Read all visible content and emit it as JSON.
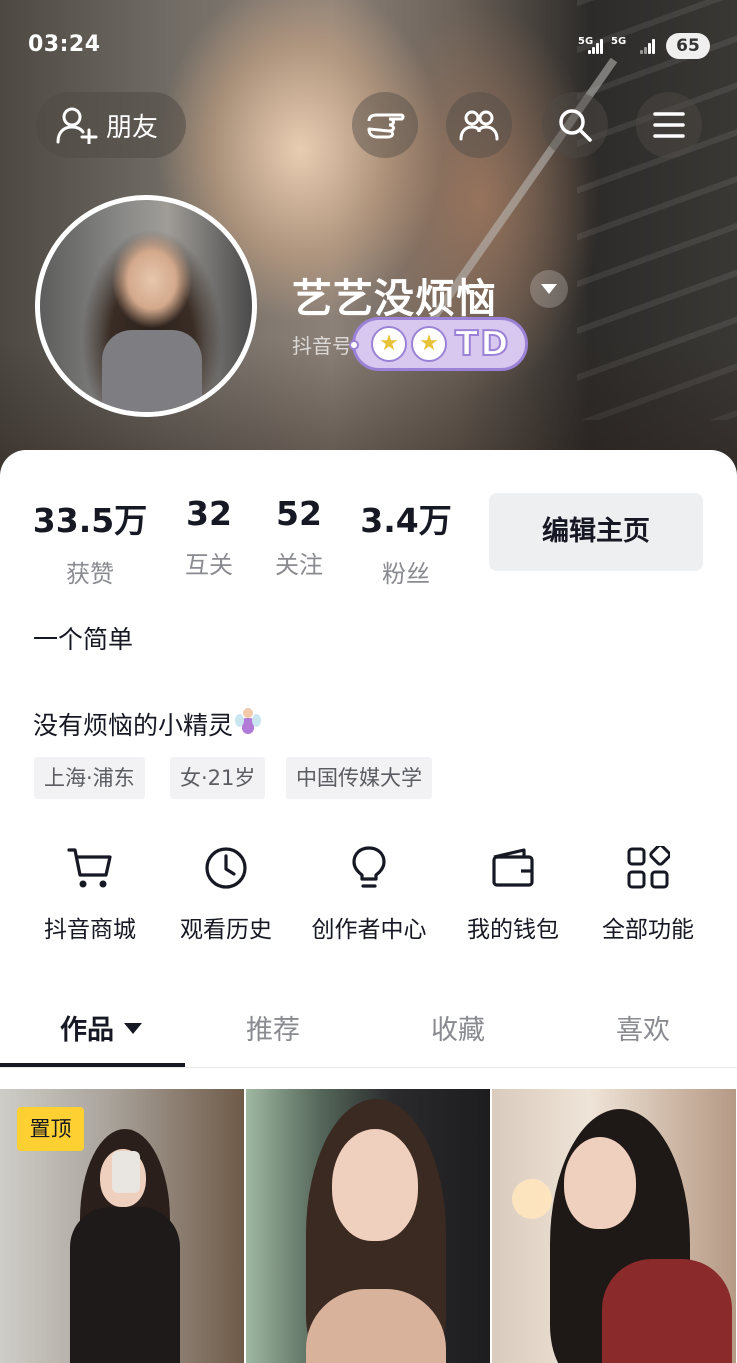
{
  "status_bar": {
    "time": "03:24",
    "network_1": "5G",
    "network_2": "5G",
    "battery": "65"
  },
  "header": {
    "friend_button": "朋友",
    "icons": [
      "hand-pointer-icon",
      "people-icon",
      "search-icon",
      "menu-icon"
    ]
  },
  "profile": {
    "username": "艺艺没烦恼",
    "douyin_id": "抖音号",
    "badge_text": "TD",
    "badge_stars": [
      "★",
      "★"
    ]
  },
  "stats": [
    {
      "value": "33.5万",
      "label": "获赞"
    },
    {
      "value": "32",
      "label": "互关"
    },
    {
      "value": "52",
      "label": "关注"
    },
    {
      "value": "3.4万",
      "label": "粉丝"
    }
  ],
  "edit_button": "编辑主页",
  "bio": {
    "line1": "一个简单",
    "line2": "没有烦恼的小精灵"
  },
  "tags": [
    "上海·浦东",
    "女·21岁",
    "中国传媒大学"
  ],
  "functions": [
    {
      "icon": "cart-icon",
      "label": "抖音商城"
    },
    {
      "icon": "clock-icon",
      "label": "观看历史"
    },
    {
      "icon": "lightbulb-icon",
      "label": "创作者中心"
    },
    {
      "icon": "wallet-icon",
      "label": "我的钱包"
    },
    {
      "icon": "grid-apps-icon",
      "label": "全部功能"
    }
  ],
  "tabs": [
    {
      "label": "作品",
      "active": true
    },
    {
      "label": "推荐",
      "active": false
    },
    {
      "label": "收藏",
      "active": false
    },
    {
      "label": "喜欢",
      "active": false
    }
  ],
  "grid": {
    "pinned_label": "置顶"
  },
  "colors": {
    "accent_text": "#161823",
    "secondary_text": "#8a8b91",
    "pin_yellow": "#fed032",
    "badge_purple": "#9b82d6"
  }
}
